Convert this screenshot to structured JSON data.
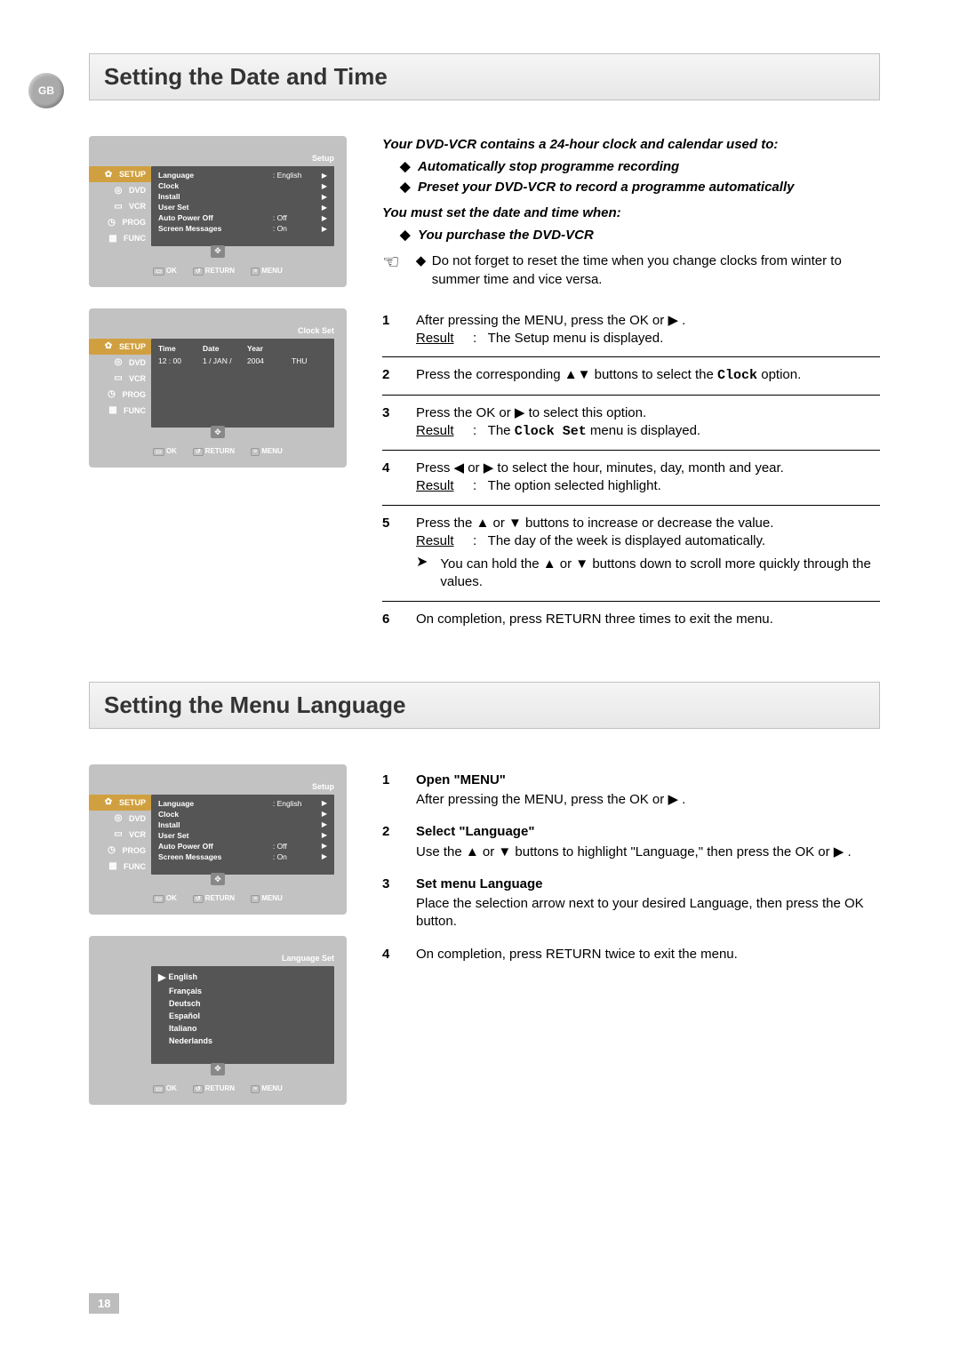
{
  "page_number": "18",
  "gb_label": "GB",
  "section1_title": "Setting the Date and Time",
  "section2_title": "Setting the Menu Language",
  "screen_setup": {
    "titlebar": "Setup",
    "side": [
      "SETUP",
      "DVD",
      "VCR",
      "PROG",
      "FUNC"
    ],
    "rows": [
      {
        "label": "Language",
        "value": ": English"
      },
      {
        "label": "Clock",
        "value": ""
      },
      {
        "label": "Install",
        "value": ""
      },
      {
        "label": "User Set",
        "value": ""
      },
      {
        "label": "Auto Power Off",
        "value": ": Off"
      },
      {
        "label": "Screen Messages",
        "value": ": On"
      }
    ],
    "footer": {
      "ok": "OK",
      "return": "RETURN",
      "menu": "MENU"
    }
  },
  "screen_clock": {
    "titlebar": "Clock Set",
    "headers": [
      "Time",
      "Date",
      "Year",
      ""
    ],
    "values": [
      "12 : 00",
      "1 / JAN /",
      "2004",
      "THU"
    ]
  },
  "screen_lang": {
    "titlebar": "Language Set",
    "items": [
      "English",
      "Français",
      "Deutsch",
      "Español",
      "Italiano",
      "Nederlands"
    ]
  },
  "intro1": "Your DVD-VCR contains a 24-hour clock and calendar used to:",
  "intro1_bullets": [
    "Automatically stop programme recording",
    "Preset your DVD-VCR to record a programme automatically"
  ],
  "intro2": "You must set the date and time when:",
  "intro2_bullets": [
    "You purchase the DVD-VCR"
  ],
  "note1": "Do not forget to reset the time when you change clocks from winter to summer time and vice versa.",
  "steps": [
    {
      "n": "1",
      "text": "After pressing the MENU, press the OK or ▶ .",
      "result": "The Setup menu is displayed."
    },
    {
      "n": "2",
      "text": "Press the corresponding ▲▼ buttons to select the ",
      "mono": "Clock",
      "text2": " option."
    },
    {
      "n": "3",
      "text": "Press the OK or ▶ to select this option.",
      "result": "The ",
      "mono": "Clock Set",
      "result2": " menu is displayed."
    },
    {
      "n": "4",
      "text": "Press ◀ or ▶ to select the hour, minutes, day, month and year.",
      "result": "The option selected highlight."
    },
    {
      "n": "5",
      "text": "Press the ▲ or ▼ buttons to increase or decrease the value.",
      "result": "The day of the week is displayed automatically.",
      "subnote": "You can hold the ▲ or ▼ buttons down to scroll more quickly through the values."
    },
    {
      "n": "6",
      "text": "On completion, press RETURN three times to exit the menu."
    }
  ],
  "steps2": [
    {
      "n": "1",
      "title": "Open \"MENU\"",
      "text": "After pressing the MENU, press the OK or ▶ ."
    },
    {
      "n": "2",
      "title": "Select \"Language\"",
      "text": "Use the ▲ or ▼ buttons to highlight \"Language,\" then press the OK or ▶ ."
    },
    {
      "n": "3",
      "title": "Set menu Language",
      "text": "Place the selection arrow next to your desired Language, then press the OK button."
    },
    {
      "n": "4",
      "title": "",
      "text": "On completion, press RETURN twice to exit the menu."
    }
  ]
}
